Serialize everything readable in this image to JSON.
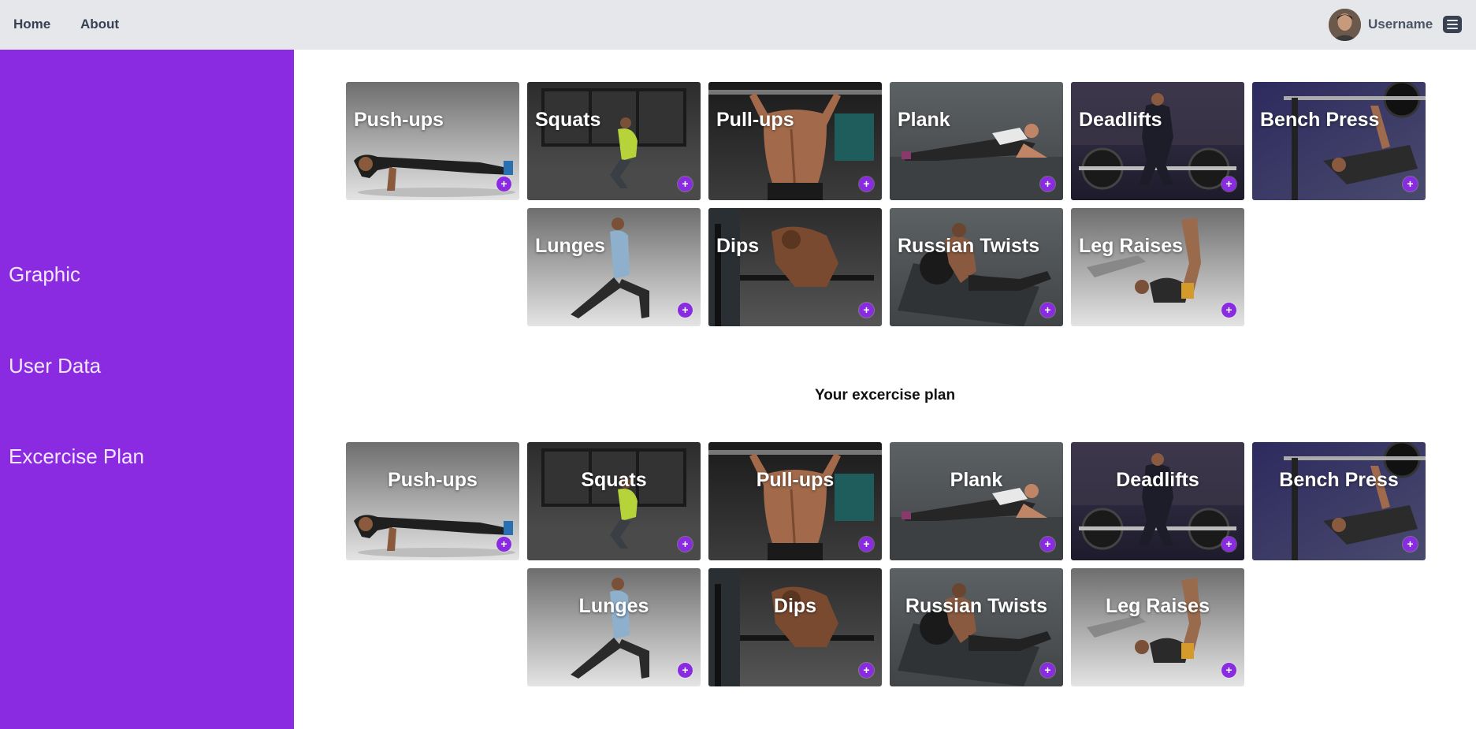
{
  "header": {
    "nav": [
      {
        "label": "Home"
      },
      {
        "label": "About"
      }
    ],
    "username": "Username",
    "menu_icon": "hamburger-icon",
    "avatar_icon": "user-avatar"
  },
  "sidebar": {
    "items": [
      {
        "label": "Graphic"
      },
      {
        "label": "User Data"
      },
      {
        "label": "Excercise Plan"
      }
    ],
    "color": "#8a2be2"
  },
  "exercises": [
    {
      "label": "Push-ups"
    },
    {
      "label": "Squats"
    },
    {
      "label": "Pull-ups"
    },
    {
      "label": "Plank"
    },
    {
      "label": "Deadlifts"
    },
    {
      "label": "Bench Press"
    },
    {
      "label": "Lunges"
    },
    {
      "label": "Dips"
    },
    {
      "label": "Russian Twists"
    },
    {
      "label": "Leg Raises"
    }
  ],
  "plan": {
    "title": "Your excercise plan",
    "exercises": [
      {
        "label": "Push-ups"
      },
      {
        "label": "Squats"
      },
      {
        "label": "Pull-ups"
      },
      {
        "label": "Plank"
      },
      {
        "label": "Deadlifts"
      },
      {
        "label": "Bench Press"
      },
      {
        "label": "Lunges"
      },
      {
        "label": "Dips"
      },
      {
        "label": "Russian Twists"
      },
      {
        "label": "Leg Raises"
      }
    ]
  },
  "add_button_symbol": "+",
  "accent_color": "#8a2be2"
}
